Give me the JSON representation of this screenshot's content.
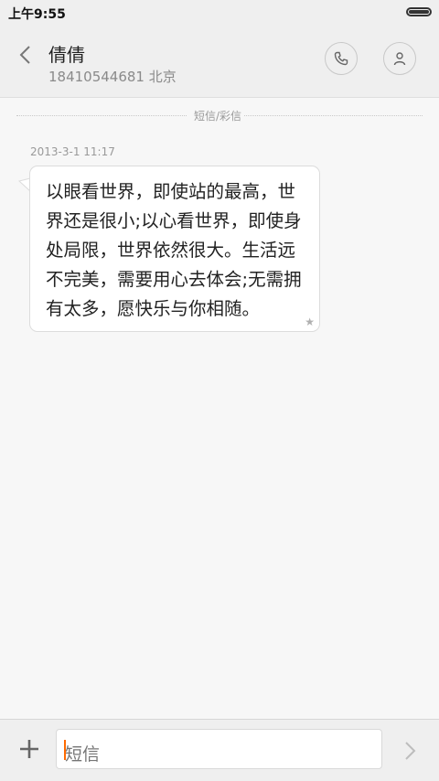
{
  "status_bar": {
    "time": "上午9:55",
    "battery_icon": "battery-icon"
  },
  "header": {
    "back_icon": "chevron-left-icon",
    "contact_name": "倩倩",
    "contact_detail": "18410544681 北京",
    "call_icon": "phone-icon",
    "contact_icon": "person-icon"
  },
  "conversation": {
    "divider_label": "短信/彩信",
    "messages": [
      {
        "timestamp": "2013-3-1 11:17",
        "text": "以眼看世界，即使站的最高，世界还是很小;以心看世界，即使身处局限，世界依然很大。生活远不完美，需要用心去体会;无需拥有太多，愿快乐与你相随。",
        "star_icon": "star-icon"
      }
    ]
  },
  "composer": {
    "add_icon": "plus-icon",
    "placeholder": "短信",
    "send_icon": "chevron-right-icon",
    "cursor_color": "#ff6a00"
  }
}
